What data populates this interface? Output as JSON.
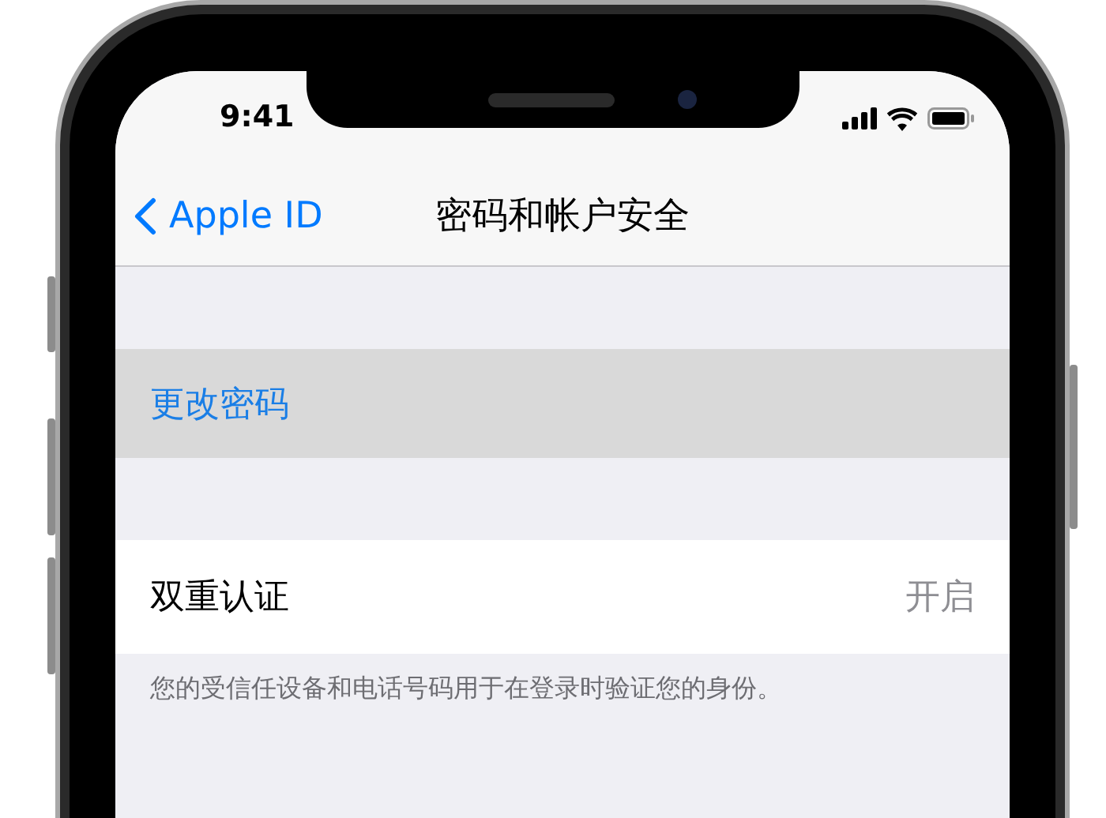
{
  "status_bar": {
    "time": "9:41"
  },
  "nav": {
    "back": "Apple ID",
    "title": "密码和帐户安全"
  },
  "sections": [
    {
      "rows": [
        {
          "kind": "action",
          "label": "更改密码",
          "selected": true
        }
      ]
    },
    {
      "rows": [
        {
          "kind": "setting",
          "label": "双重认证",
          "value": "开启",
          "selected": false
        }
      ],
      "footer": "您的受信任设备和电话号码用于在登录时验证您的身份。"
    }
  ]
}
